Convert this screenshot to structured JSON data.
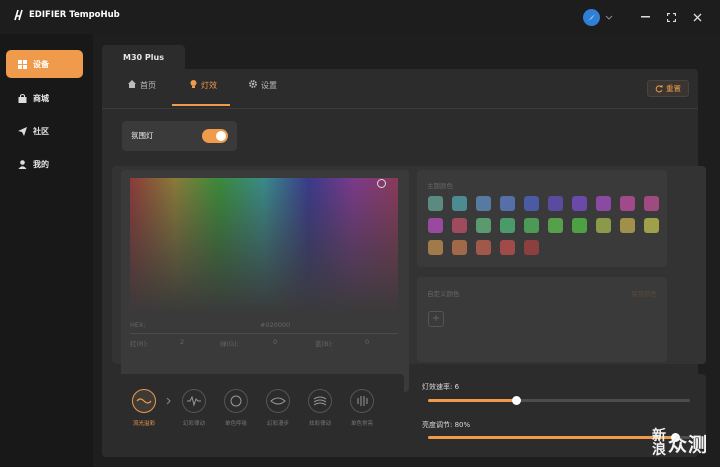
{
  "app": {
    "title": "EDIFIER TempoHub"
  },
  "sidebar": {
    "items": [
      {
        "label": "设备",
        "icon": "grid-icon"
      },
      {
        "label": "商城",
        "icon": "bag-icon"
      },
      {
        "label": "社区",
        "icon": "paper-plane-icon"
      },
      {
        "label": "我的",
        "icon": "user-icon"
      }
    ]
  },
  "device": {
    "name": "M30 Plus"
  },
  "tabs": [
    {
      "label": "首页",
      "icon": "home-icon"
    },
    {
      "label": "灯效",
      "icon": "bulb-icon"
    },
    {
      "label": "设置",
      "icon": "gear-icon"
    }
  ],
  "reset_label": "重置",
  "ambient": {
    "label": "氛围灯",
    "on": true
  },
  "picker": {
    "hex_label": "HEX:",
    "hex_value": "#020000",
    "r_label": "红(R):",
    "r_value": "2",
    "g_label": "绿(G):",
    "g_value": "0",
    "b_label": "蓝(B):",
    "b_value": "0"
  },
  "presets": {
    "label": "主题颜色",
    "colors": [
      "#5a8a80",
      "#4e8a92",
      "#587aa0",
      "#5570a8",
      "#4a5aa4",
      "#5a4aa0",
      "#6a4aa8",
      "#8a4aa2",
      "#a04a8c",
      "#a04a82",
      "#9a4a9e",
      "#a04a5e",
      "#5a9a6e",
      "#4a9a6a",
      "#4c9a55",
      "#56a04c",
      "#4ea045",
      "#8a9a4a",
      "#a0904a",
      "#a0a04a",
      "#a07a4a",
      "#a06a4a",
      "#a0584a",
      "#a04a4a",
      "#8c3f3f"
    ]
  },
  "custom": {
    "label": "自定义颜色",
    "edit": "保存颜色"
  },
  "effects": [
    {
      "label": "流光溢彩",
      "icon": "wave-icon"
    },
    {
      "label": "幻彩律动",
      "icon": "pulse-icon"
    },
    {
      "label": "单色呼吸",
      "icon": "circle-icon"
    },
    {
      "label": "幻彩漫步",
      "icon": "eye-icon"
    },
    {
      "label": "炫彩律动",
      "icon": "swirl-icon"
    },
    {
      "label": "单色常亮",
      "icon": "bars-icon"
    }
  ],
  "sliders": {
    "speed": {
      "label": "灯效速率: 6",
      "value": 6,
      "max": 10
    },
    "brightness": {
      "label": "亮度调节: 80%",
      "value": 80,
      "max": 100
    }
  },
  "watermark": {
    "big1": "新",
    "small1": "浪",
    "small2": "",
    "rest": "众测"
  },
  "colors": {
    "accent": "#f09a4c",
    "background": "#141414",
    "panel": "#2c2c2c"
  }
}
